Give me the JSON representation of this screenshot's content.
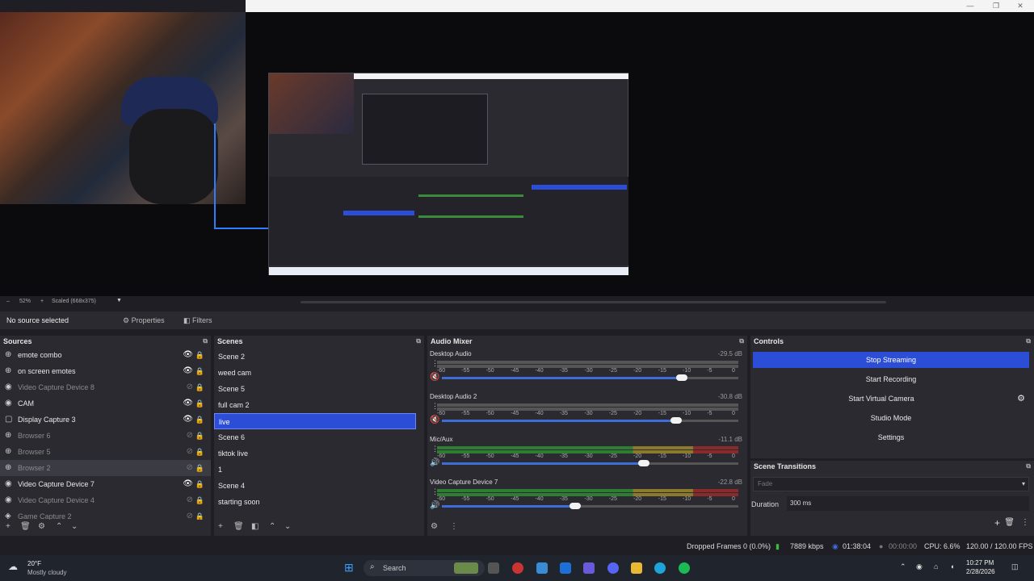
{
  "window": {
    "minimize": "—",
    "maximize": "❐",
    "close": "✕"
  },
  "preview": {
    "zoom": "52%",
    "scaled": "Scaled (668x375)"
  },
  "sourcebar": {
    "selected": "No source selected",
    "properties": "Properties",
    "filters": "Filters"
  },
  "sources": {
    "title": "Sources",
    "items": [
      {
        "label": "emote combo",
        "visible": true,
        "icon": "globe-icon"
      },
      {
        "label": "on screen emotes",
        "visible": true,
        "icon": "globe-icon"
      },
      {
        "label": "Video Capture Device 8",
        "visible": false,
        "icon": "camera-icon"
      },
      {
        "label": "CAM",
        "visible": true,
        "icon": "camera-icon"
      },
      {
        "label": "Display Capture 3",
        "visible": true,
        "icon": "monitor-icon"
      },
      {
        "label": "Browser 6",
        "visible": false,
        "icon": "globe-icon"
      },
      {
        "label": "Browser 5",
        "visible": false,
        "icon": "globe-icon"
      },
      {
        "label": "Browser 2",
        "visible": false,
        "icon": "globe-icon"
      },
      {
        "label": "Video Capture Device 7",
        "visible": true,
        "icon": "camera-icon"
      },
      {
        "label": "Video Capture Device 4",
        "visible": false,
        "icon": "camera-icon"
      },
      {
        "label": "Game Capture 2",
        "visible": false,
        "icon": "gamepad-icon"
      }
    ]
  },
  "scenes": {
    "title": "Scenes",
    "items": [
      "Scene 2",
      "weed cam",
      "Scene 5",
      "full cam 2",
      "live",
      "Scene 6",
      "tiktok live",
      "1",
      "Scene 4",
      "starting soon"
    ],
    "active": "live"
  },
  "mixer": {
    "title": "Audio Mixer",
    "channels": [
      {
        "name": "Desktop Audio",
        "db": "-29.5 dB",
        "level": 0.81,
        "muted": true
      },
      {
        "name": "Desktop Audio 2",
        "db": "-30.8 dB",
        "level": 0.79,
        "muted": true
      },
      {
        "name": "Mic/Aux",
        "db": "-11.1 dB",
        "level": 0.68,
        "muted": false
      },
      {
        "name": "Video Capture Device 7",
        "db": "-22.8 dB",
        "level": 0.45,
        "muted": false
      }
    ],
    "scale": [
      "-60",
      "-55",
      "-50",
      "-45",
      "-40",
      "-35",
      "-30",
      "-25",
      "-20",
      "-15",
      "-10",
      "-5",
      "0"
    ]
  },
  "controls": {
    "title": "Controls",
    "stop_streaming": "Stop Streaming",
    "start_recording": "Start Recording",
    "start_virtual_camera": "Start Virtual Camera",
    "studio_mode": "Studio Mode",
    "settings": "Settings"
  },
  "transitions": {
    "title": "Scene Transitions",
    "selected": "Fade",
    "duration_label": "Duration",
    "duration_value": "300 ms"
  },
  "status": {
    "dropped_frames": "Dropped Frames 0 (0.0%)",
    "bitrate": "7889 kbps",
    "stream_time": "01:38:04",
    "rec_time": "00:00:00",
    "cpu": "CPU: 6.6%",
    "fps": "120.00 / 120.00 FPS"
  },
  "taskbar": {
    "weather_temp": "20°F",
    "weather_desc": "Mostly cloudy",
    "search": "Search",
    "time": "10:27 PM",
    "date": "2/28/2026"
  },
  "colors": {
    "accent": "#2c4dd6",
    "panel": "#2b2a31",
    "background": "#1f1e24"
  }
}
